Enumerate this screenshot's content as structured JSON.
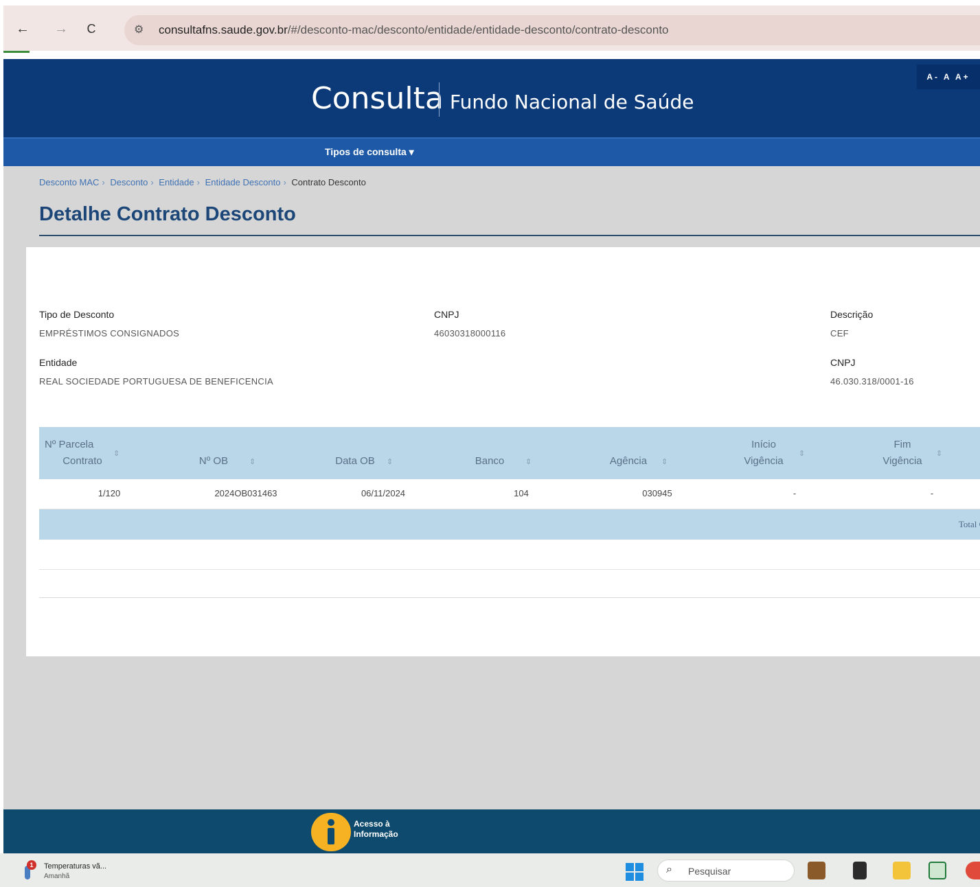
{
  "browser": {
    "url_host": "consultafns.saude.gov.br",
    "url_path": "/#/desconto-mac/desconto/entidade/entidade-desconto/contrato-desconto"
  },
  "header": {
    "brand": "Consulta",
    "subtitle": "Fundo Nacional de Saúde",
    "font_tools": "A- A A+"
  },
  "menu": {
    "label": "Tipos de consulta ▾"
  },
  "breadcrumb": {
    "items": [
      "Desconto MAC",
      "Desconto",
      "Entidade",
      "Entidade Desconto"
    ],
    "current": "Contrato Desconto"
  },
  "page": {
    "title": "Detalhe Contrato Desconto"
  },
  "fields": {
    "tipo_label": "Tipo de Desconto",
    "tipo_value": "EMPRÉSTIMOS CONSIGNADOS",
    "cnpj1_label": "CNPJ",
    "cnpj1_value": "46030318000116",
    "descontado_label": "Descrição",
    "descontado_value": "CEF",
    "entidade_label": "Entidade",
    "entidade_value": "REAL SOCIEDADE PORTUGUESA DE BENEFICENCIA",
    "cnpj2_label": "CNPJ",
    "cnpj2_value": "46.030.318/0001-16"
  },
  "table": {
    "headers": {
      "parcela_1": "Nº Parcela",
      "parcela_2": "Contrato",
      "ob": "Nº OB",
      "data_ob": "Data OB",
      "banco": "Banco",
      "agencia": "Agência",
      "inicio_1": "Início",
      "inicio_2": "Vigência",
      "fim_1": "Fim",
      "fim_2": "Vigência"
    },
    "rows": [
      {
        "parcela": "1/120",
        "ob": "2024OB031463",
        "data_ob": "06/11/2024",
        "banco": "104",
        "agencia": "030945",
        "inicio": "-",
        "fim": "-"
      }
    ],
    "footer_total": "Total G"
  },
  "footer": {
    "ai_line1": "Acesso à",
    "ai_line2": "Informação"
  },
  "taskbar": {
    "weather_title": "Temperaturas vã...",
    "weather_sub": "Amanhã",
    "weather_badge": "1",
    "search_placeholder": "Pesquisar"
  },
  "colors": {
    "header_blue": "#0c3a78",
    "menu_blue": "#1d59a6",
    "table_head": "#bad6e9",
    "footer": "#0d4a6d",
    "accent_yellow": "#f6b222"
  }
}
